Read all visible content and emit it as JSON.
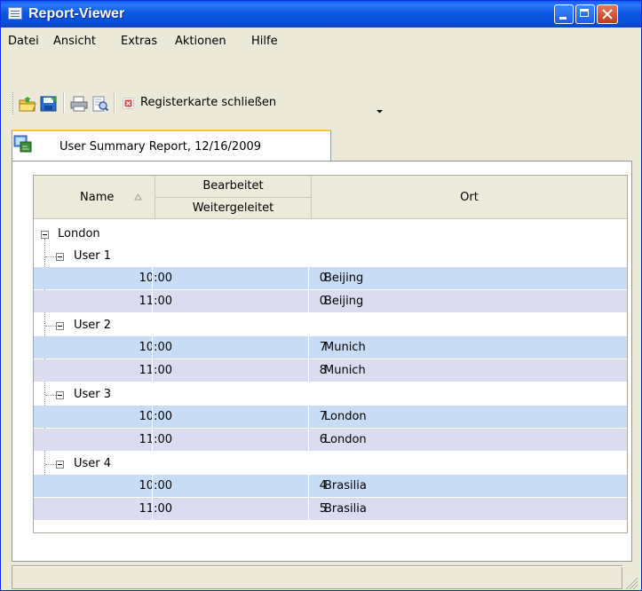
{
  "window": {
    "title": "Report-Viewer"
  },
  "menu": [
    "Datei",
    "Ansicht",
    "Extras",
    "Aktionen",
    "Hilfe"
  ],
  "toolbar": {
    "icons": [
      "open-folder-icon",
      "save-icon",
      "print-icon",
      "print-preview-icon"
    ],
    "close_tab_label": "Registerkarte schließen"
  },
  "tab": {
    "label": "User Summary Report, 12/16/2009"
  },
  "grid": {
    "headers": {
      "name": "Name",
      "bearbeitet": "Bearbeitet",
      "weitergeleitet": "Weitergeleitet",
      "ort": "Ort"
    },
    "root": "London",
    "groups": [
      {
        "name": "User 1",
        "rows": [
          {
            "time": "10:00",
            "value": "0",
            "ort": "Beijing"
          },
          {
            "time": "11:00",
            "value": "0",
            "ort": "Beijing"
          }
        ]
      },
      {
        "name": "User 2",
        "rows": [
          {
            "time": "10:00",
            "value": "7",
            "ort": "Munich"
          },
          {
            "time": "11:00",
            "value": "8",
            "ort": "Munich"
          }
        ]
      },
      {
        "name": "User 3",
        "rows": [
          {
            "time": "10:00",
            "value": "7",
            "ort": "London"
          },
          {
            "time": "11:00",
            "value": "6",
            "ort": "London"
          }
        ]
      },
      {
        "name": "User 4",
        "rows": [
          {
            "time": "10:00",
            "value": "4",
            "ort": "Brasilia"
          },
          {
            "time": "11:00",
            "value": "5",
            "ort": "Brasilia"
          }
        ]
      }
    ]
  }
}
